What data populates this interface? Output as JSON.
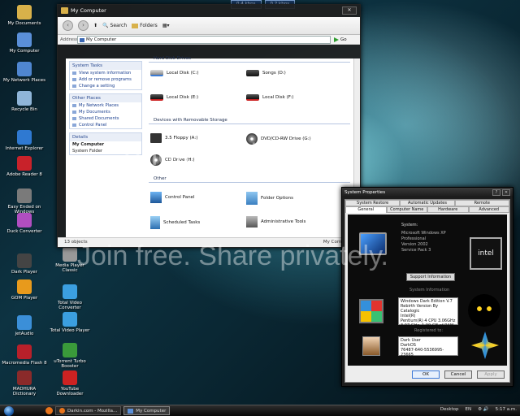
{
  "speed": {
    "down": "0.4 kbps",
    "up": "0.2 kbps"
  },
  "desktop_icons": [
    {
      "label": "My Documents",
      "icon": "folder-icon",
      "color": "#d8b14a"
    },
    {
      "label": "My Computer",
      "icon": "computer-icon",
      "color": "#5a8fd8"
    },
    {
      "label": "My Network Places",
      "icon": "network-icon",
      "color": "#4f86d0"
    },
    {
      "label": "Recycle Bin",
      "icon": "recycle-bin-icon",
      "color": "#8fb5d8"
    },
    {
      "label": "Internet Explorer",
      "icon": "ie-icon",
      "color": "#2f79d1"
    },
    {
      "label": "Adobe Reader 8",
      "icon": "adobe-reader-icon",
      "color": "#c8222a"
    },
    {
      "label": "Easy Ended on Windows",
      "icon": "shortcut-icon",
      "color": "#7a7a7a"
    },
    {
      "label": "Duck Converter",
      "icon": "converter-icon",
      "color": "#b04ec0"
    },
    {
      "label": "Dark Player",
      "icon": "player-icon",
      "color": "#444"
    },
    {
      "label": "GOM Player",
      "icon": "gom-player-icon",
      "color": "#e89a1c"
    },
    {
      "label": "jetAudio",
      "icon": "jetaudio-icon",
      "color": "#3b8fd8"
    },
    {
      "label": "Macromedia Flash 8",
      "icon": "flash-icon",
      "color": "#b8202a"
    },
    {
      "label": "MADHURA Dictionary",
      "icon": "dictionary-icon",
      "color": "#8a2a2a"
    },
    {
      "label": "Media Player Classic",
      "icon": "media-player-icon",
      "color": "#999"
    },
    {
      "label": "Total Video Converter",
      "icon": "video-converter-icon",
      "color": "#3b9fe0"
    },
    {
      "label": "Total Video Player",
      "icon": "video-player-icon",
      "color": "#3b9fe0"
    },
    {
      "label": "uTorrent Turbo Booster",
      "icon": "utorrent-icon",
      "color": "#3a9a3a"
    },
    {
      "label": "YouTube Downloader",
      "icon": "youtube-icon",
      "color": "#cc2222"
    }
  ],
  "explorer": {
    "title": "My Computer",
    "toolbar": {
      "back": "Back",
      "search": "Search",
      "folders": "Folders"
    },
    "address_label": "Address",
    "address_value": "My Computer",
    "go_label": "Go",
    "system_tasks": {
      "heading": "System Tasks",
      "items": [
        "View system information",
        "Add or remove programs",
        "Change a setting"
      ]
    },
    "other_places": {
      "heading": "Other Places",
      "items": [
        "My Network Places",
        "My Documents",
        "Shared Documents",
        "Control Panel"
      ]
    },
    "details": {
      "heading": "Details",
      "name": "My Computer",
      "type": "System Folder"
    },
    "sections": {
      "hard_disks": "Hard Disk Drives",
      "removable": "Devices with Removable Storage",
      "other": "Other"
    },
    "drives": [
      "Local Disk (C:)",
      "Songs (D:)",
      "Local Disk (E:)",
      "Local Disk (F:)"
    ],
    "removable_items": [
      "3.5 Floppy (A:)",
      "DVD/CD-RW Drive (G:)",
      "CD Drive (H:)"
    ],
    "other_items": [
      "Control Panel",
      "Folder Options",
      "Scheduled Tasks",
      "Administrative Tools"
    ],
    "status_left": "13 objects",
    "status_right": "My Computer"
  },
  "sysprops": {
    "title": "System Properties",
    "tabs_top": [
      "System Restore",
      "Automatic Updates",
      "Remote"
    ],
    "tabs_bottom": [
      "General",
      "Computer Name",
      "Hardware",
      "Advanced"
    ],
    "system_heading": "System:",
    "system_lines": [
      "Microsoft Windows XP",
      "Professional",
      "Version 2002",
      "Service Pack 3"
    ],
    "support_button": "Support Information",
    "sysinfo_heading": "System Information",
    "info_lines": [
      "Windows Dark Edition V.7",
      "Rebirth Version By Catalogic",
      "Intel(R)",
      "Pentium(R) 4 CPU 3.06GHz",
      "3.07 GHz, 1.99 GB of RAM"
    ],
    "registered_heading": "Registered to:",
    "registered_lines": [
      "Dark User",
      "DarkOS",
      "76487-640-5536995-23665"
    ],
    "intel_label": "intel",
    "buttons": {
      "ok": "OK",
      "cancel": "Cancel",
      "apply": "Apply"
    }
  },
  "taskbar": {
    "items": [
      "Darkin.com - Mozilla...",
      "My Computer"
    ],
    "desktop_label": "Desktop",
    "lang": "EN",
    "clock": "5:17 a.m."
  },
  "watermark": {
    "brand": "photobucket",
    "slogan": "Join free. Share privately."
  }
}
